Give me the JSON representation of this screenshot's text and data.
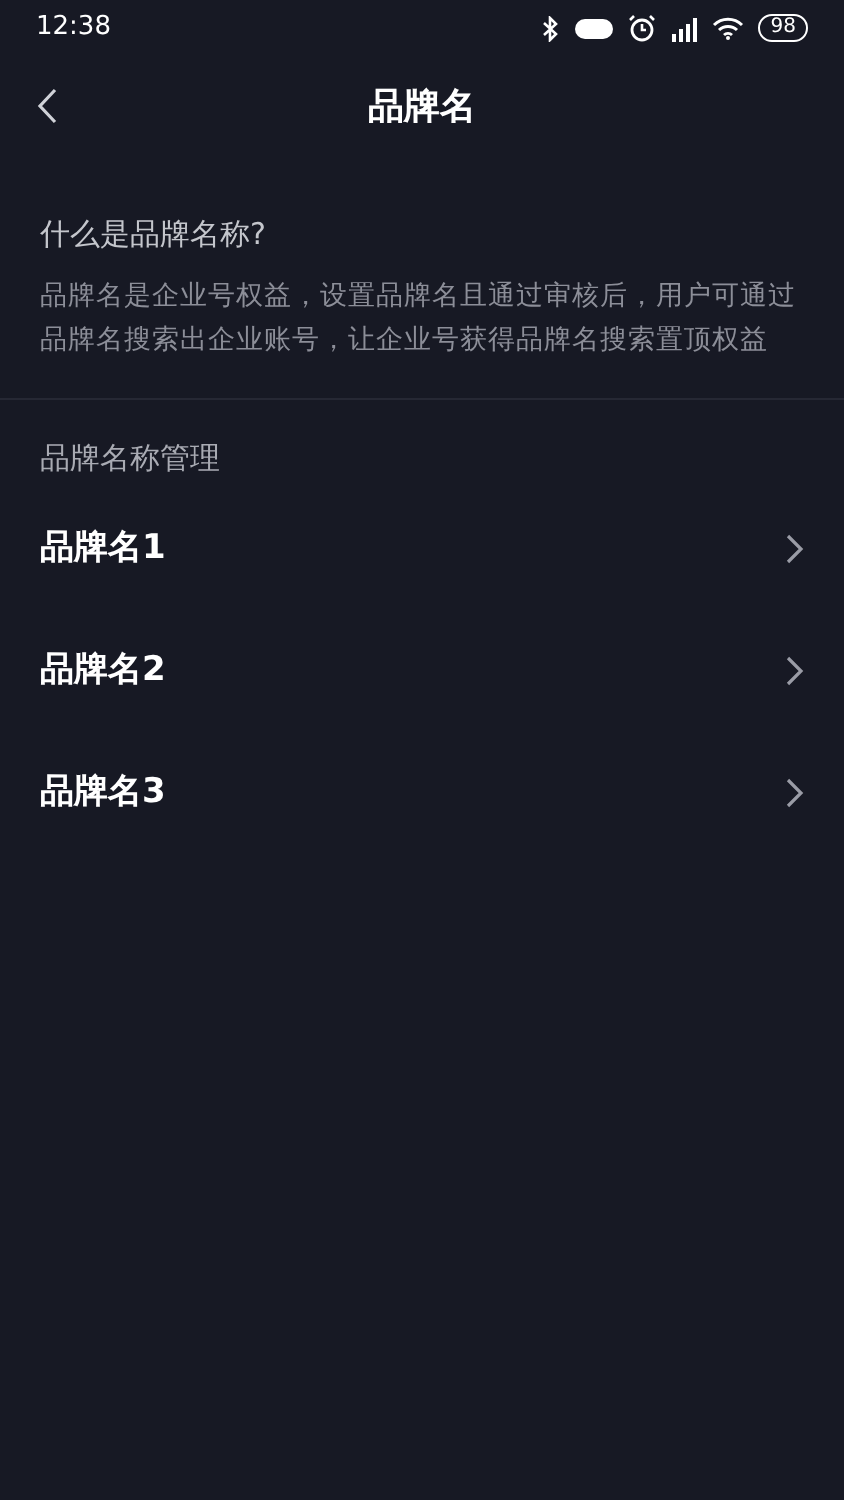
{
  "status_bar": {
    "time": "12:38",
    "battery": "98"
  },
  "header": {
    "title": "品牌名"
  },
  "intro": {
    "heading": "什么是品牌名称?",
    "body": "品牌名是企业号权益，设置品牌名且通过审核后，用户可通过品牌名搜索出企业账号，让企业号获得品牌名搜索置顶权益"
  },
  "section": {
    "title": "品牌名称管理"
  },
  "items": [
    {
      "label": "品牌名1"
    },
    {
      "label": "品牌名2"
    },
    {
      "label": "品牌名3"
    }
  ]
}
